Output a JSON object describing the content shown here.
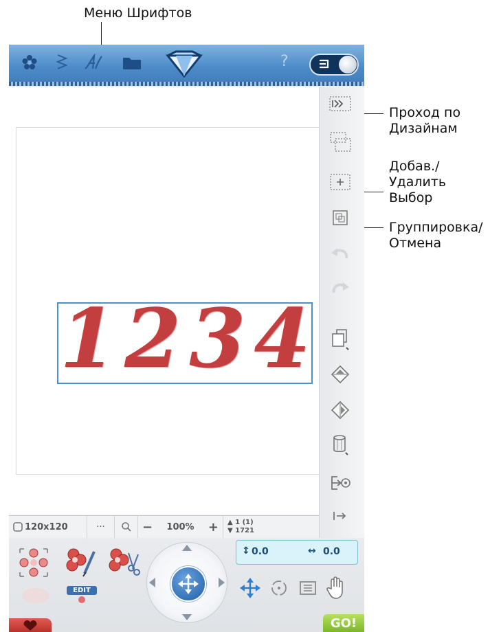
{
  "annotations": {
    "font_menu": "Меню Шрифтов",
    "step_designs": [
      "Проход по",
      "Дизайнам"
    ],
    "add_remove_selection": [
      "Добав./",
      "Удалить",
      "Выбор"
    ],
    "group_ungroup": [
      "Группировка/",
      "Отмена"
    ]
  },
  "design": {
    "text": "1234"
  },
  "status_bar": {
    "hoop_size": "120x120",
    "more": "···",
    "zoom_out": "−",
    "zoom_level": "100%",
    "zoom_in": "+",
    "color_blocks": "1 (1)",
    "stitch_count": "1721"
  },
  "position": {
    "y": "0.0",
    "x": "0.0"
  },
  "bottom_panel": {
    "edit_label": "EDIT",
    "go_label": "GO!"
  },
  "colors": {
    "topbar": "#4d8bc8",
    "design_red": "#c33e3e",
    "selection_blue": "#4e8fcf",
    "go_green": "#7cb72a",
    "favorite_red": "#c7372f"
  }
}
